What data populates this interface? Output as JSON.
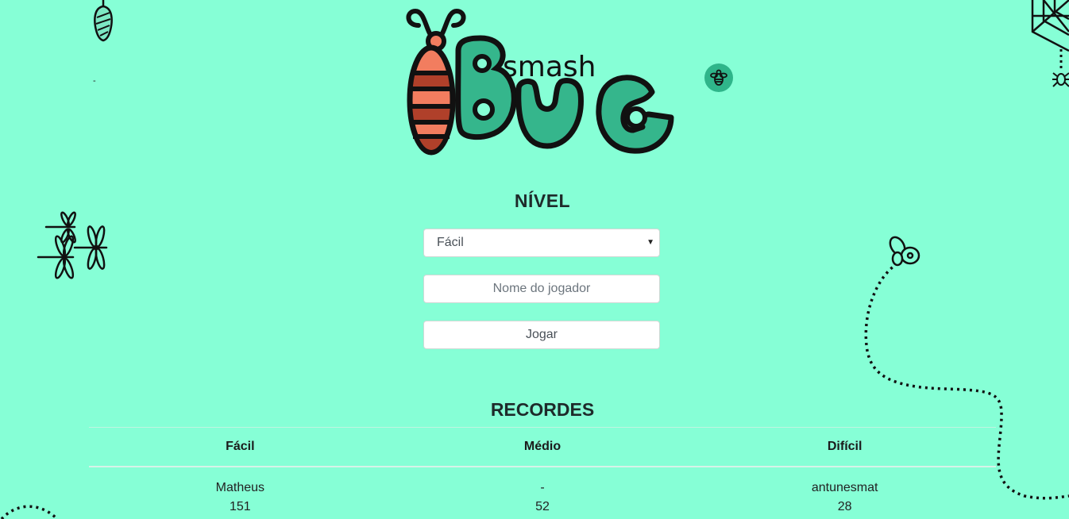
{
  "logo": {
    "small_text": "smash",
    "big_text": "BUG"
  },
  "decoration": {
    "dash": "-"
  },
  "form": {
    "level_heading": "NÍVEL",
    "level_selected": "Fácil",
    "player_placeholder": "Nome do jogador",
    "play_label": "Jogar"
  },
  "records": {
    "heading": "RECORDES",
    "columns": [
      "Fácil",
      "Médio",
      "Difícil"
    ],
    "names": [
      "Matheus",
      "-",
      "antunesmat"
    ],
    "scores": [
      "151",
      "52",
      "28"
    ]
  },
  "colors": {
    "background": "#86ffd6",
    "logo_green": "#35b68c",
    "bug_orange": "#f27d5f",
    "bug_red": "#b0402a"
  }
}
